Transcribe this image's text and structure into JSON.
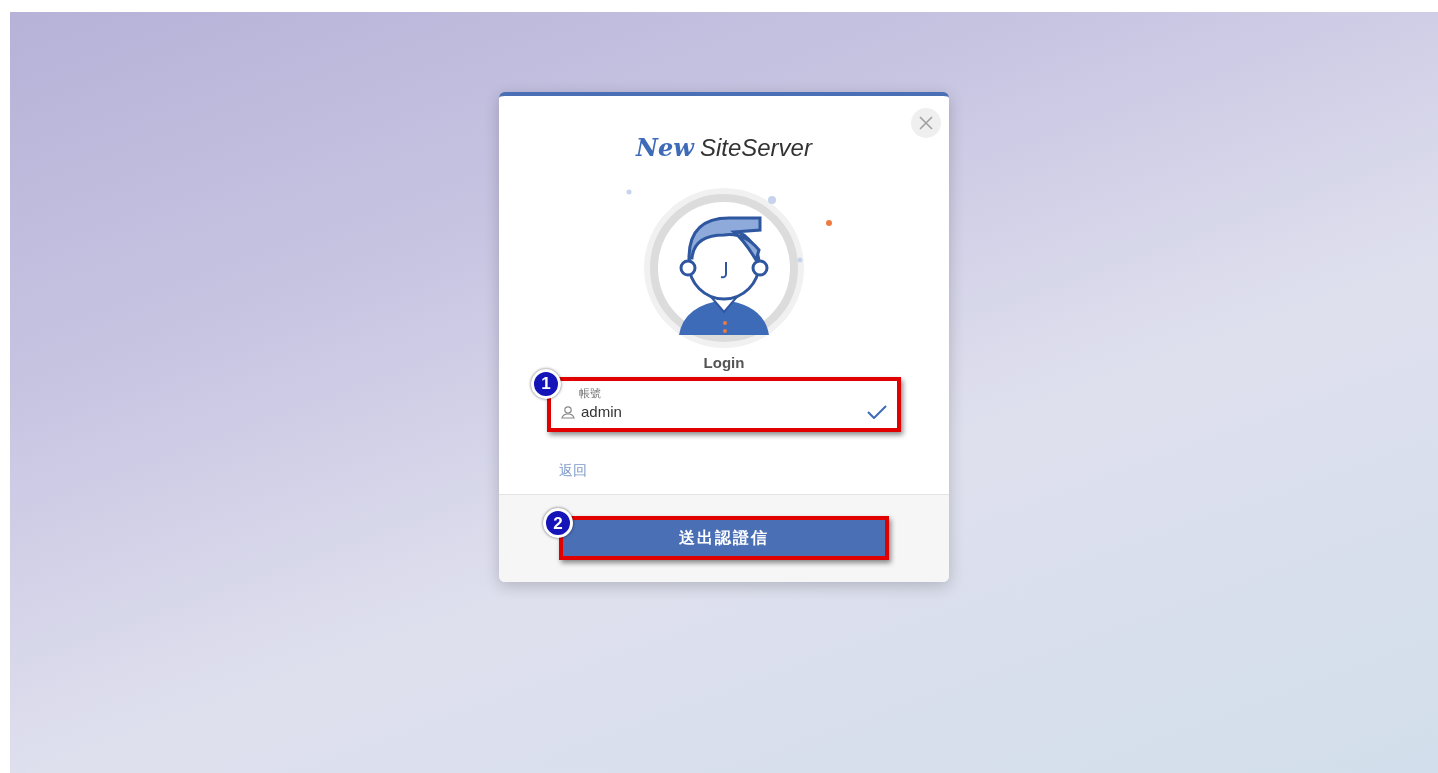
{
  "dialog": {
    "logo": {
      "script": "New",
      "name": "SiteServer"
    },
    "heading": "Login",
    "account_field": {
      "label": "帳號",
      "value": "admin",
      "valid": true
    },
    "back_link": "返回",
    "submit_button": "送出認證信"
  },
  "annotations": [
    {
      "number": "1"
    },
    {
      "number": "2"
    }
  ]
}
